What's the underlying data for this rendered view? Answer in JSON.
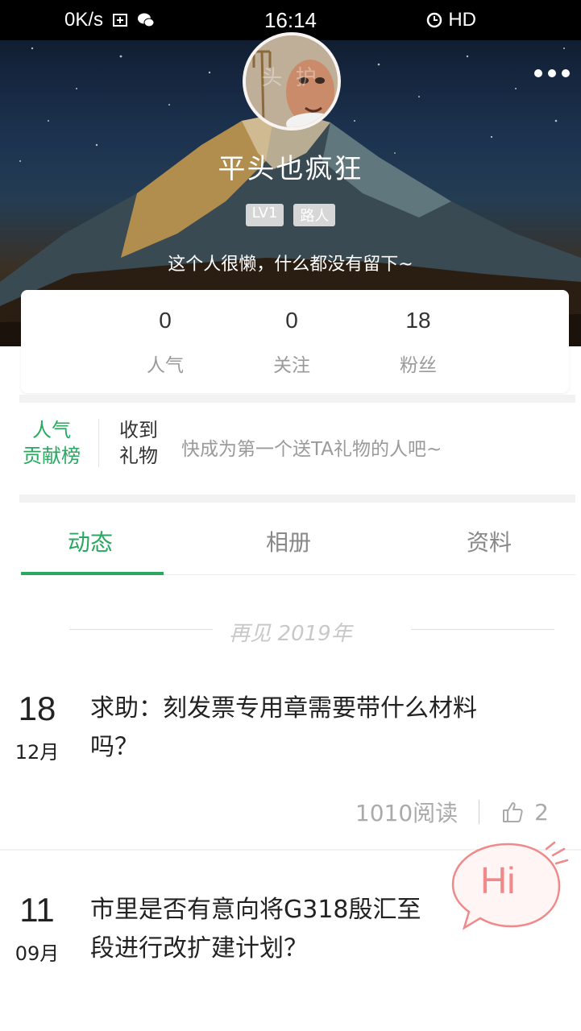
{
  "status_bar": {
    "speed": "0K/s",
    "time": "16:14",
    "network": "HD"
  },
  "profile": {
    "avatar_watermark": "头 护",
    "nickname": "平头也疯狂",
    "level_badge": "LV1",
    "rank_badge": "路人",
    "bio": "这个人很懒，什么都没有留下~"
  },
  "stats": [
    {
      "value": "0",
      "label": "人气"
    },
    {
      "value": "0",
      "label": "关注"
    },
    {
      "value": "18",
      "label": "粉丝"
    }
  ],
  "gifts": {
    "rank_label_line1": "人气",
    "rank_label_line2": "贡献榜",
    "received_line1": "收到",
    "received_line2": "礼物",
    "hint": "快成为第一个送TA礼物的人吧~"
  },
  "tabs": [
    {
      "label": "动态",
      "active": true
    },
    {
      "label": "相册",
      "active": false
    },
    {
      "label": "资料",
      "active": false
    }
  ],
  "year_separator": "再见 2019年",
  "posts": [
    {
      "day": "18",
      "month": "12月",
      "title_line1": "求助：刻发票专用章需要带什么材料",
      "title_line2": "吗？",
      "reads": "1010阅读",
      "likes": "2"
    },
    {
      "day": "11",
      "month": "09月",
      "title_line1": "市里是否有意向将G318殷汇至",
      "title_line2": "段进行改扩建计划？"
    }
  ],
  "hi_button": "Hi",
  "colors": {
    "accent": "#2aa860",
    "hi": "#f08a8a"
  },
  "icons": {
    "more": "more-dots-icon",
    "like": "thumbs-up-icon"
  }
}
